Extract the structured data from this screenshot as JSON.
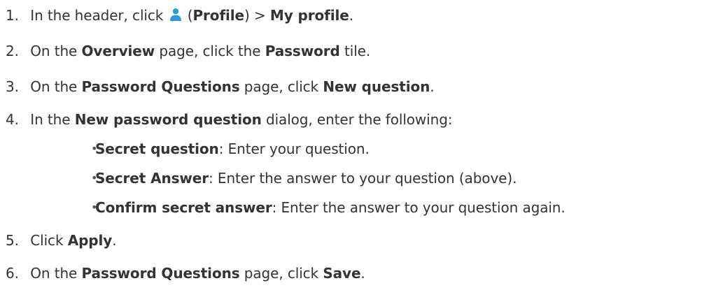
{
  "steps": [
    {
      "number": "1.",
      "t1": "In the header, click",
      "icon_name": "profile-icon",
      "icon_color": "#2a9bd6",
      "t2": " (",
      "b1": "Profile",
      "t3": ") > ",
      "b2": "My profile",
      "t4": "."
    },
    {
      "number": "2.",
      "t1": "On the ",
      "b1": "Overview",
      "t2": " page, click the ",
      "b2": "Password",
      "t3": " tile."
    },
    {
      "number": "3.",
      "t1": "On the ",
      "b1": "Password Questions",
      "t2": " page, click ",
      "b2": "New question",
      "t3": "."
    },
    {
      "number": "4.",
      "t1": "In the ",
      "b1": "New password question",
      "t2": " dialog, enter the following:",
      "substeps": [
        {
          "bullet": "•",
          "b1": "Secret question",
          "t1": ": Enter your question."
        },
        {
          "bullet": "•",
          "b1": "Secret Answer",
          "t1": ": Enter the answer to your question (above)."
        },
        {
          "bullet": "•",
          "b1": "Confirm secret answer",
          "t1": ": Enter the answer to your question again."
        }
      ]
    },
    {
      "number": "5.",
      "t1": "Click ",
      "b1": "Apply",
      "t2": "."
    },
    {
      "number": "6.",
      "t1": "On the ",
      "b1": "Password Questions",
      "t2": " page, click ",
      "b2": "Save",
      "t3": "."
    }
  ]
}
